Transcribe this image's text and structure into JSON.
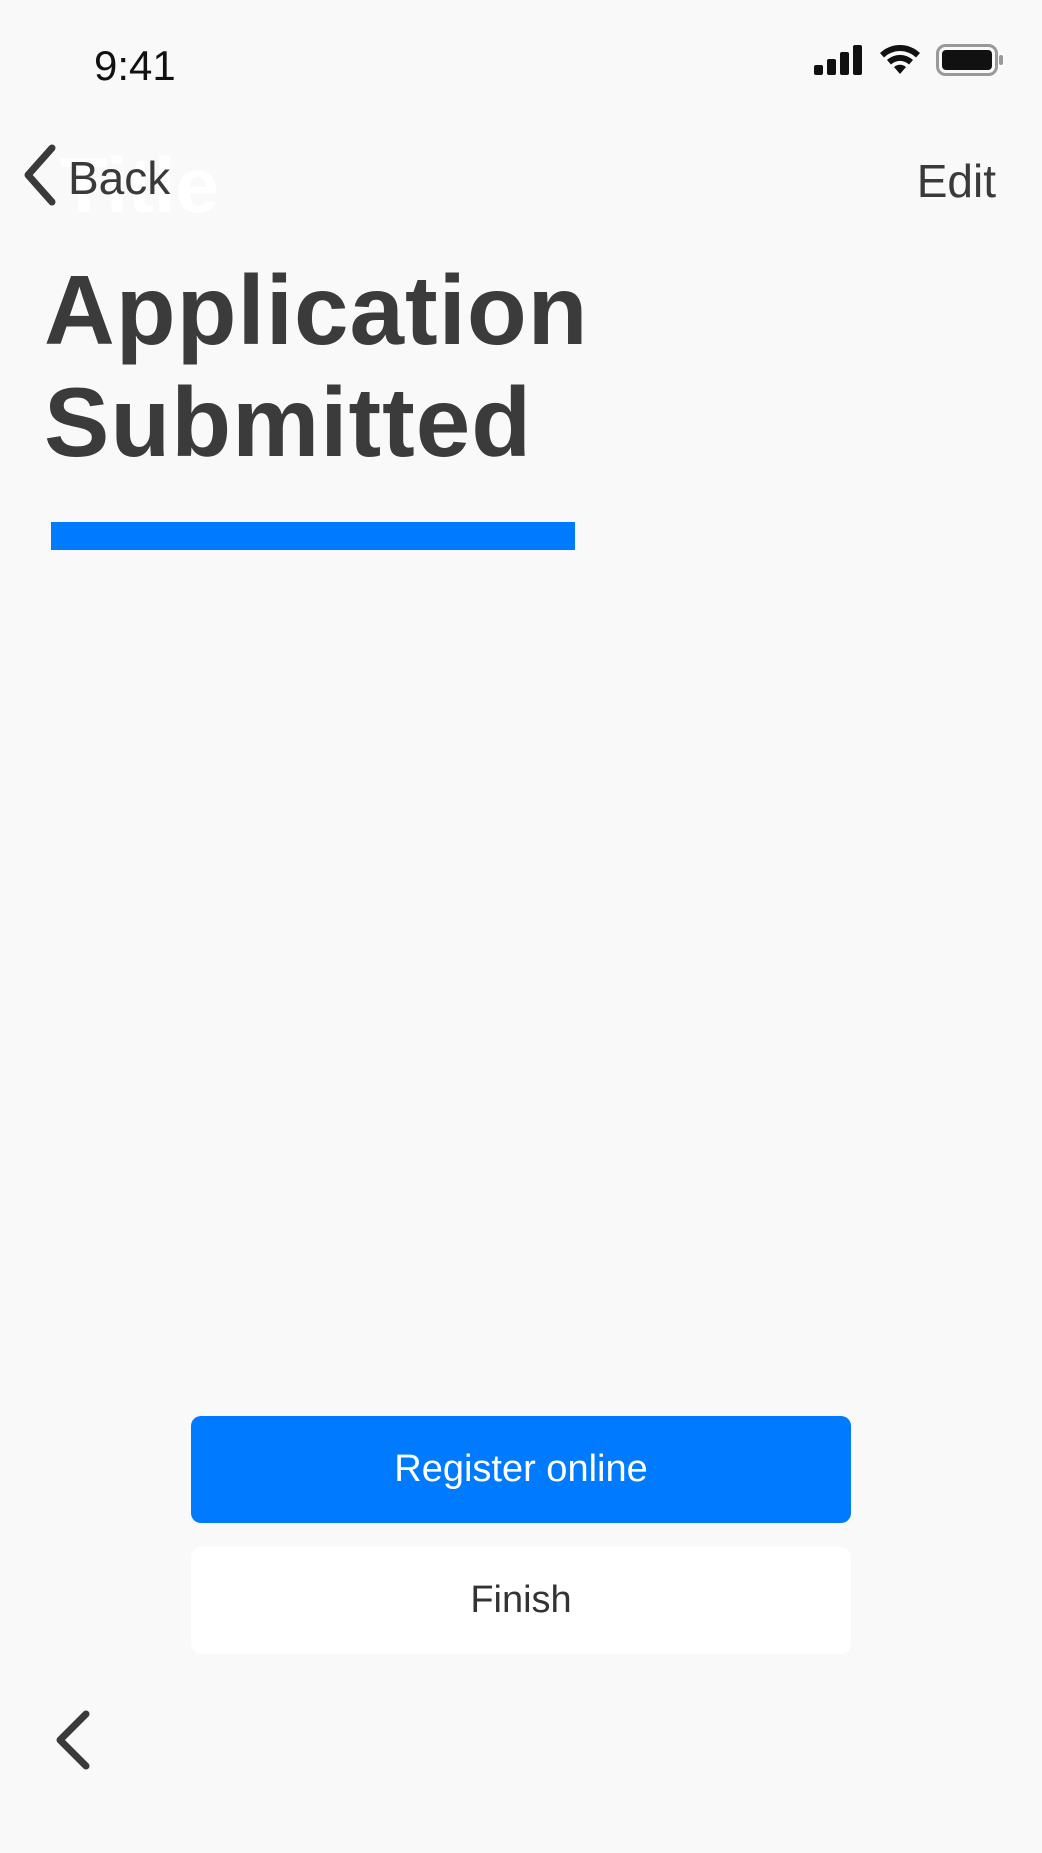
{
  "status_bar": {
    "time": "9:41"
  },
  "nav": {
    "ghost_title": "Title",
    "back_label": "Back",
    "edit_label": "Edit"
  },
  "page": {
    "title": "Application Submitted"
  },
  "actions": {
    "primary_label": "Register online",
    "secondary_label": "Finish"
  },
  "colors": {
    "accent": "#007aff",
    "background": "#f9f9f9",
    "text": "#3b3b3b"
  },
  "icons": {
    "signal": "cellular-signal-icon",
    "wifi": "wifi-icon",
    "battery": "battery-icon",
    "back": "chevron-left-icon"
  }
}
